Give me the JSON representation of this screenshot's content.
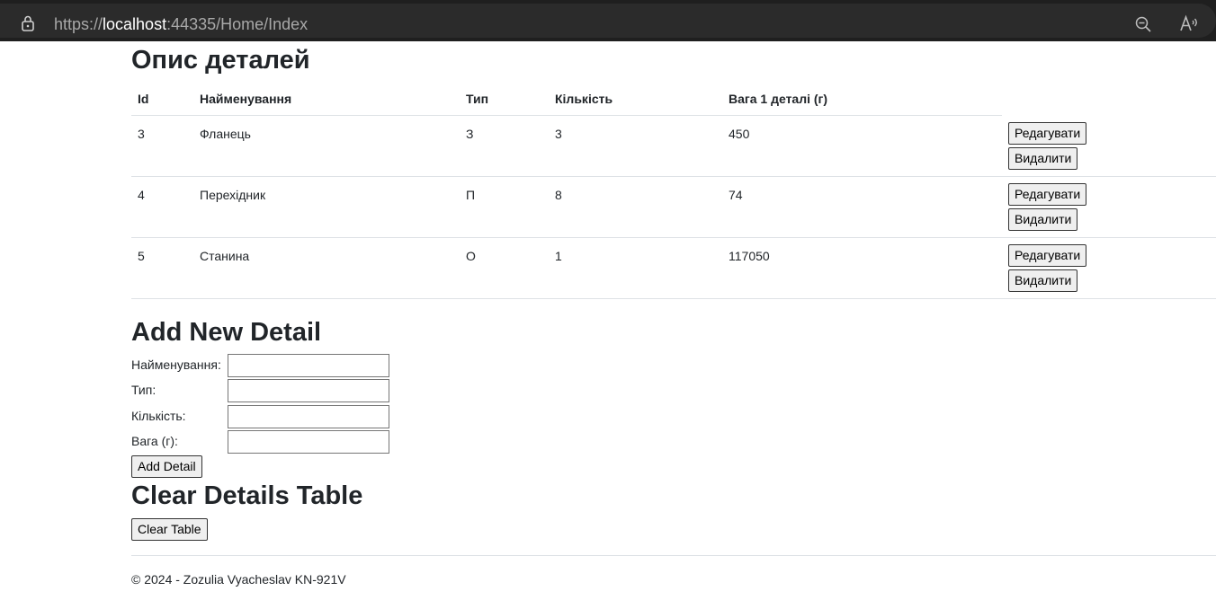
{
  "browser": {
    "url_scheme": "https://",
    "url_host": "localhost",
    "url_rest": ":44335/Home/Index",
    "icons": [
      "lock-icon",
      "zoom-out-icon",
      "read-aloud-icon"
    ]
  },
  "page": {
    "title": "Опис деталей",
    "table": {
      "headers": [
        "Id",
        "Найменування",
        "Тип",
        "Кількість",
        "Вага 1 деталі (г)"
      ],
      "rows": [
        {
          "id": "3",
          "name": "Фланець",
          "type": "З",
          "qty": "3",
          "weight": "450"
        },
        {
          "id": "4",
          "name": "Перехідник",
          "type": "П",
          "qty": "8",
          "weight": "74"
        },
        {
          "id": "5",
          "name": "Станина",
          "type": "О",
          "qty": "1",
          "weight": "117050"
        }
      ],
      "edit_label": "Редагувати",
      "delete_label": "Видалити"
    },
    "add_form": {
      "title": "Add New Detail",
      "name_label": "Найменування:",
      "type_label": "Тип:",
      "qty_label": "Кількість:",
      "weight_label": "Вага (г):",
      "name_value": "",
      "type_value": "",
      "qty_value": "",
      "weight_value": "",
      "submit_label": "Add Detail"
    },
    "clear": {
      "title": "Clear Details Table",
      "button_label": "Clear Table"
    },
    "footer": "© 2024 - Zozulia Vyacheslav KN-921V"
  }
}
